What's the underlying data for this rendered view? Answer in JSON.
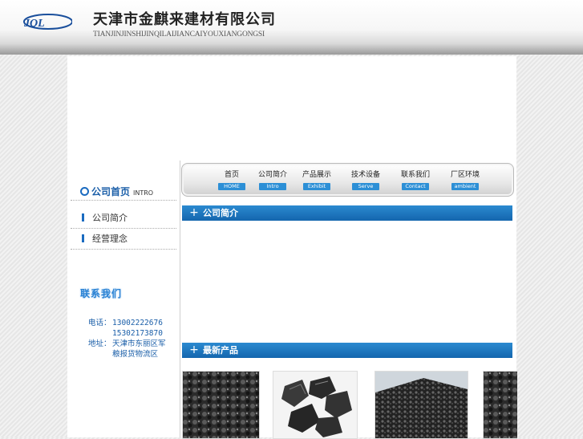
{
  "header": {
    "company_cn": "天津市金麒来建材有限公司",
    "company_en": "TIANJINJINSHIJINQILAIJIANCAIYOUXIANGONGSI"
  },
  "nav": [
    {
      "cn": "首页",
      "en": "HOME"
    },
    {
      "cn": "公司简介",
      "en": "Intro"
    },
    {
      "cn": "产品展示",
      "en": "Exhibit"
    },
    {
      "cn": "技术设备",
      "en": "Serve"
    },
    {
      "cn": "联系我们",
      "en": "Contact"
    },
    {
      "cn": "厂区环境",
      "en": "ambient"
    }
  ],
  "sidebar": {
    "title": "公司首页",
    "title_en": "INTRO",
    "items": [
      "公司简介",
      "经营理念"
    ],
    "contact_title": "联系我们",
    "phone_label": "电话：",
    "phone1": "13002222676",
    "phone2": "15302173870",
    "address_label": "地址：",
    "address_line1": "天津市东丽区军",
    "address_line2": "粮报货物流区"
  },
  "sections": {
    "intro_title": "公司简介",
    "products_title": "最新产品"
  },
  "colors": {
    "accent": "#1a6bc0",
    "section_bar": "#1e78c2"
  }
}
